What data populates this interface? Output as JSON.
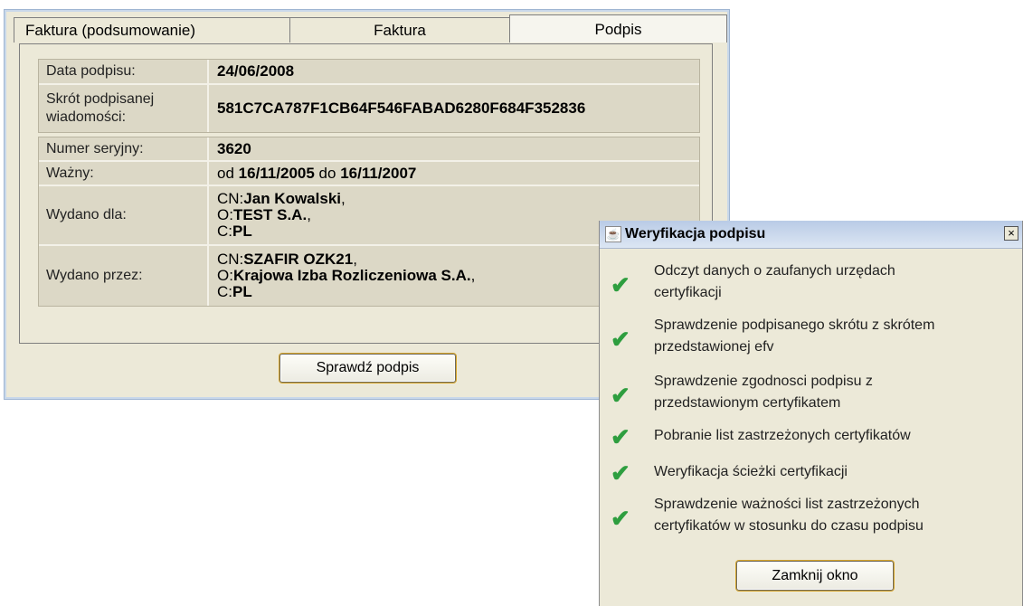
{
  "tabs": [
    "Faktura (podsumowanie)",
    "Faktura",
    "Podpis"
  ],
  "signature": {
    "date_label": "Data podpisu:",
    "date_value": "24/06/2008",
    "digest_label_l1": "Skrót podpisanej",
    "digest_label_l2": "wiadomości:",
    "digest_value": "581C7CA787F1CB64F546FABAD6280F684F352836"
  },
  "certificate": {
    "serial_label": "Numer seryjny:",
    "serial_value": "3620",
    "valid_label": "Ważny:",
    "valid_from_prefix": "od",
    "valid_from": "16/11/2005",
    "valid_to_prefix": "do",
    "valid_to": "16/11/2007",
    "issued_to_label": "Wydano dla:",
    "issued_to": [
      {
        "prefix": "CN:",
        "value": "Jan Kowalski",
        "suffix": ","
      },
      {
        "prefix": "O:",
        "value": "TEST S.A.",
        "suffix": ","
      },
      {
        "prefix": "C:",
        "value": "PL",
        "suffix": ""
      }
    ],
    "issued_by_label": "Wydano przez:",
    "issued_by": [
      {
        "prefix": "CN:",
        "value": "SZAFIR OZK21",
        "suffix": ","
      },
      {
        "prefix": "O:",
        "value": "Krajowa Izba Rozliczeniowa S.A.",
        "suffix": ","
      },
      {
        "prefix": "C:",
        "value": "PL",
        "suffix": ""
      }
    ]
  },
  "verify_button": "Sprawdź podpis",
  "dialog": {
    "title": "Weryfikacja podpisu",
    "close_glyph": "×",
    "check_glyph": "✔",
    "steps": [
      [
        "Odczyt danych o zaufanych urzędach",
        "certyfikacji"
      ],
      [
        "Sprawdzenie podpisanego skrótu z skrótem",
        "przedstawionej efv"
      ],
      [
        "Sprawdzenie zgodnosci podpisu z",
        "przedstawionym certyfikatem"
      ],
      [
        "Pobranie list zastrzeżonych certyfikatów"
      ],
      [
        "Weryfikacja ścieżki certyfikacji"
      ],
      [
        "Sprawdzenie ważności list zastrzeżonych",
        "certyfikatów w stosunku do czasu podpisu"
      ]
    ],
    "close_button": "Zamknij okno"
  },
  "colors": {
    "check": "#2e9e3f",
    "window_bg": "#ece9d8",
    "title_bar": "#b9cbe6"
  }
}
